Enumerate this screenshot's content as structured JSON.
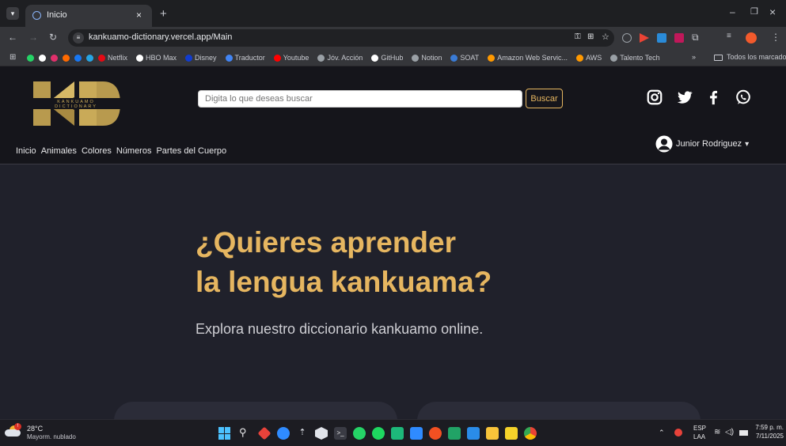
{
  "browser": {
    "tab_title": "Inicio",
    "url": "kankuamo-dictionary.vercel.app/Main",
    "bookmarks": [
      {
        "label": "",
        "color": "#25d366"
      },
      {
        "label": "",
        "color": "#ffffff"
      },
      {
        "label": "",
        "color": "#e1306c"
      },
      {
        "label": "",
        "color": "#ff6a00"
      },
      {
        "label": "",
        "color": "#1877f2"
      },
      {
        "label": "",
        "color": "#26a5e4"
      },
      {
        "label": "Netflix",
        "color": "#e50914"
      },
      {
        "label": "HBO Max",
        "color": "#ffffff"
      },
      {
        "label": "Disney",
        "color": "#113ccf"
      },
      {
        "label": "Traductor",
        "color": "#4285f4"
      },
      {
        "label": "Youtube",
        "color": "#ff0000"
      },
      {
        "label": "Jóv. Acción",
        "color": "#9aa0a6"
      },
      {
        "label": "GitHub",
        "color": "#ffffff"
      },
      {
        "label": "Notion",
        "color": "#9aa0a6"
      },
      {
        "label": "SOAT",
        "color": "#3a7bd5"
      },
      {
        "label": "Amazon Web Servic...",
        "color": "#ff9900"
      },
      {
        "label": "AWS",
        "color": "#ff9900"
      },
      {
        "label": "Talento Tech",
        "color": "#9aa0a6"
      }
    ],
    "all_bookmarks_label": "Todos los marcadores",
    "overflow_label": "»"
  },
  "site": {
    "logo": {
      "letters": "KD",
      "subtitle": "KANKUAMO DICTIONARY"
    },
    "search": {
      "placeholder": "Digita lo que deseas buscar",
      "button_label": "Buscar"
    },
    "nav": [
      "Inicio",
      "Animales",
      "Colores",
      "Números",
      "Partes del Cuerpo"
    ],
    "user": {
      "name": "Junior Rodriguez",
      "caret": "▾"
    },
    "social": [
      "instagram-icon",
      "twitter-icon",
      "facebook-icon",
      "whatsapp-icon"
    ]
  },
  "hero": {
    "title_line1": "¿Quieres aprender",
    "title_line2": "la lengua kankuama?",
    "subtitle": "Explora nuestro diccionario kankuamo online.",
    "accent_color": "#e6b660"
  },
  "taskbar": {
    "weather_temp": "28°C",
    "weather_desc": "Mayorm. nublado",
    "lang_top": "ESP",
    "lang_bottom": "LAA",
    "time": "7:59 p. m.",
    "date": "7/11/2025"
  }
}
